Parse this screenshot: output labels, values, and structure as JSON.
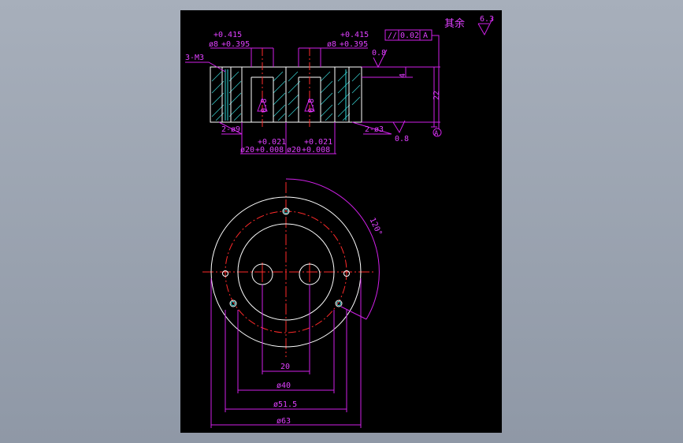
{
  "drawing": {
    "surface_note": {
      "chars": "其余",
      "roughness": "6.3"
    },
    "tolerance_frame": {
      "symbol": "//",
      "value": "0.02",
      "datum": "A"
    },
    "datum_label": "A",
    "section_view": {
      "hole_left_dim": {
        "main": "ø8",
        "upper": "+0.415",
        "lower": "+0.395"
      },
      "hole_right_dim": {
        "main": "ø8",
        "upper": "+0.415",
        "lower": "+0.395"
      },
      "thread_label": "3-M3",
      "counterbore_left": "2-ø9",
      "counterbore_right": "2-ø3",
      "roughness_top": "0.8",
      "roughness_bottom": "0.8",
      "roughness_hole_left": "0.8",
      "roughness_hole_right": "0.8",
      "depth_dim": "4",
      "height_dim": "22",
      "bore_left_dim": {
        "main": "ø20",
        "upper": "+0.021",
        "lower": "+0.008"
      },
      "bore_right_dim": {
        "main": "ø20",
        "upper": "+0.021",
        "lower": "+0.008"
      }
    },
    "plan_view": {
      "angle_dim": "120°",
      "dim_20": "20",
      "dim_40": "ø40",
      "dim_51_5": "ø51.5",
      "dim_63": "ø63"
    }
  }
}
